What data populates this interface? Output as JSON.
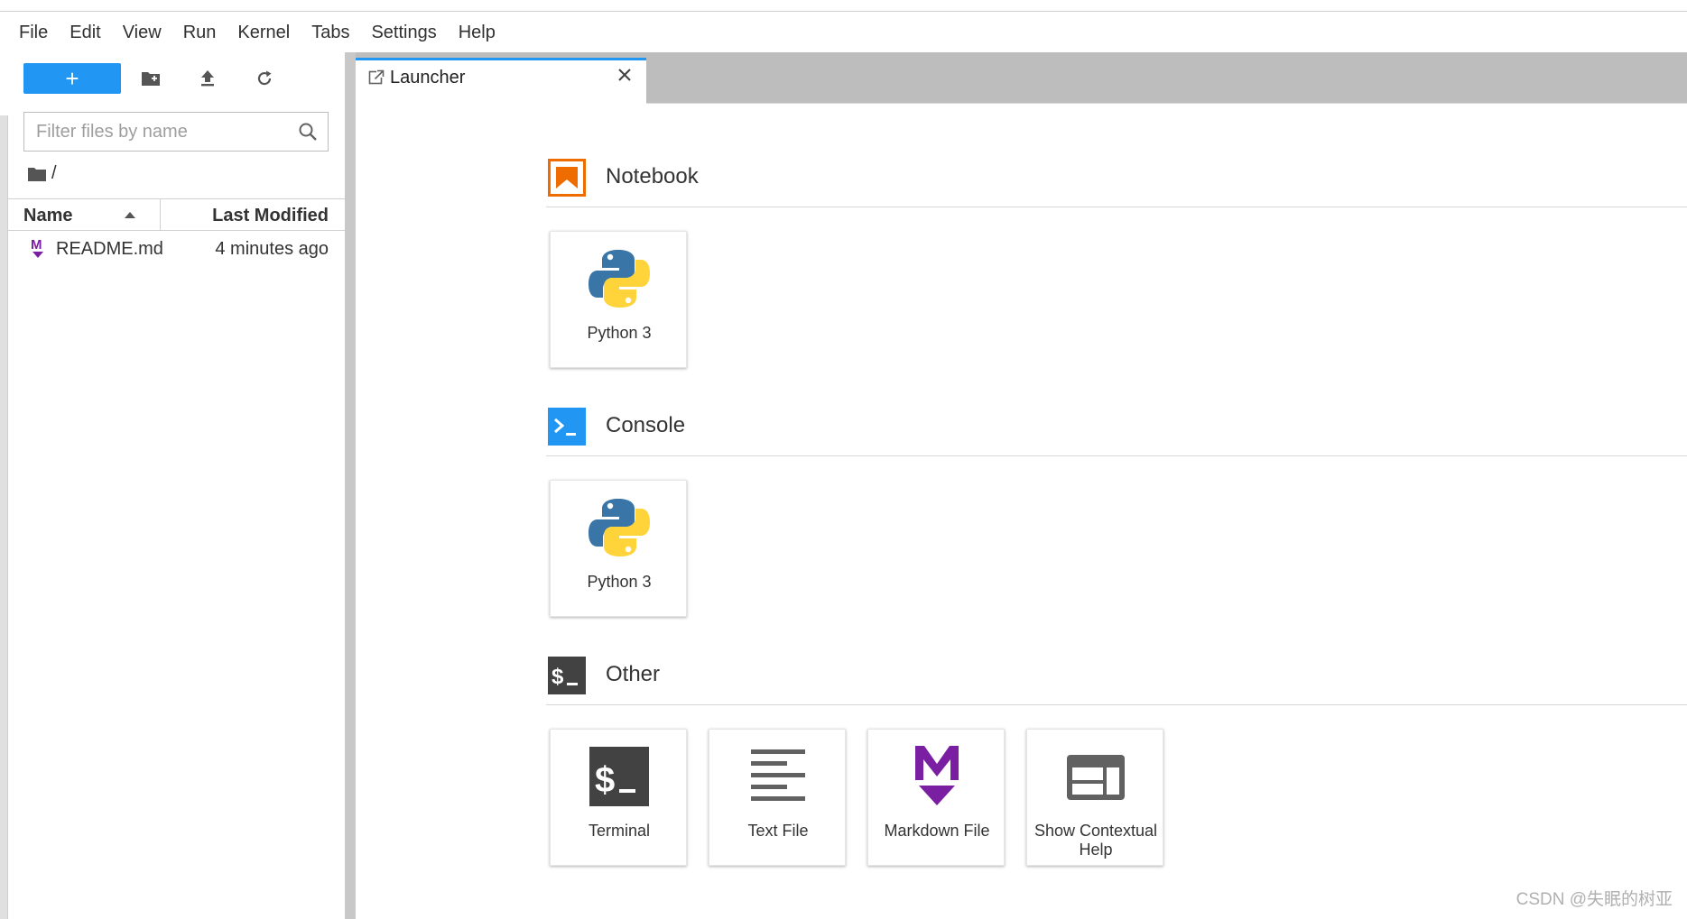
{
  "menubar": {
    "items": [
      "File",
      "Edit",
      "View",
      "Run",
      "Kernel",
      "Tabs",
      "Settings",
      "Help"
    ]
  },
  "toolbar": {
    "new_label": "+",
    "new_folder_icon": "new-folder-icon",
    "upload_icon": "upload-icon",
    "refresh_icon": "refresh-icon"
  },
  "filebrowser": {
    "filter_placeholder": "Filter files by name",
    "breadcrumb": "/",
    "columns": {
      "name": "Name",
      "modified": "Last Modified"
    },
    "files": [
      {
        "name": "README.md",
        "modified": "4 minutes ago",
        "icon": "markdown-icon"
      }
    ]
  },
  "tabs": [
    {
      "label": "Launcher",
      "icon": "launcher-icon",
      "active": true
    }
  ],
  "launcher": {
    "sections": [
      {
        "title": "Notebook",
        "icon": "notebook-icon",
        "color": "#ef6c00",
        "cards": [
          {
            "label": "Python 3",
            "icon": "python-icon"
          }
        ]
      },
      {
        "title": "Console",
        "icon": "console-icon",
        "color": "#2196f3",
        "cards": [
          {
            "label": "Python 3",
            "icon": "python-icon"
          }
        ]
      },
      {
        "title": "Other",
        "icon": "terminal-icon",
        "color": "#424242",
        "cards": [
          {
            "label": "Terminal",
            "icon": "terminal-icon"
          },
          {
            "label": "Text File",
            "icon": "text-file-icon"
          },
          {
            "label": "Markdown File",
            "icon": "markdown-icon"
          },
          {
            "label": "Show Contextual Help",
            "icon": "contextual-help-icon"
          }
        ]
      }
    ]
  },
  "watermark": "CSDN @失眠的树亚",
  "colors": {
    "accent": "#2196f3",
    "notebook": "#ef6c00",
    "markdown": "#7b1fa2",
    "python_blue": "#3a75a8",
    "python_yellow": "#ffd43b"
  }
}
